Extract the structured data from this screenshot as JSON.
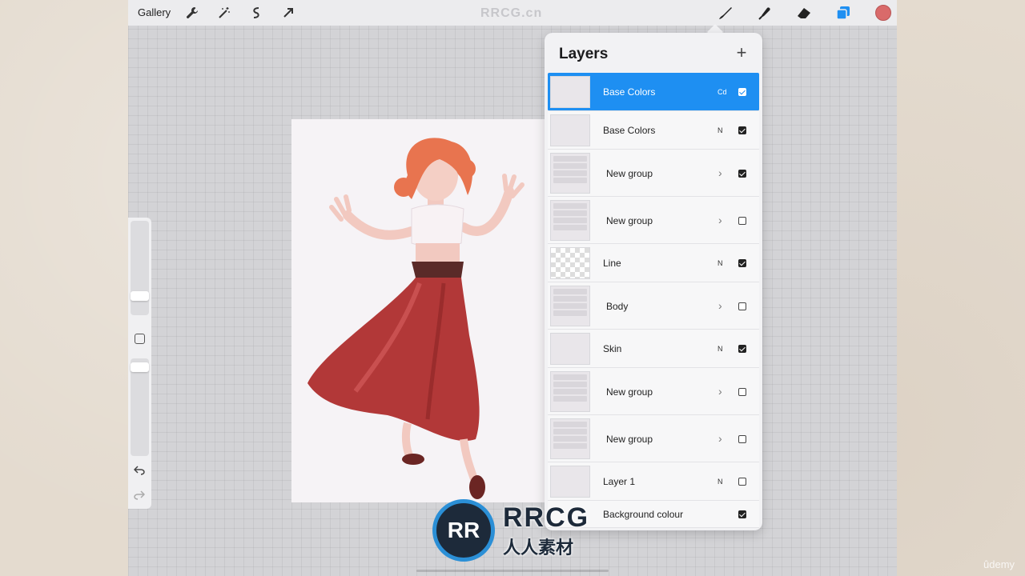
{
  "toolbar": {
    "gallery_label": "Gallery",
    "left_icons": [
      "wrench-icon",
      "magic-wand-icon",
      "selection-icon",
      "transform-arrow-icon"
    ],
    "right_icons": [
      "brush-icon",
      "smudge-icon",
      "eraser-icon",
      "layers-icon"
    ],
    "color_swatch": "#d96a6a",
    "accent": "#1e8ff2"
  },
  "watermark_top": "RRCG.cn",
  "layers_panel": {
    "title": "Layers",
    "add_icon": "+",
    "layers": [
      {
        "name": "Base Colors",
        "blend": "Cd",
        "checked": true,
        "selected": true,
        "group": false
      },
      {
        "name": "Base Colors",
        "blend": "N",
        "checked": true,
        "selected": false,
        "group": false
      },
      {
        "name": "New group",
        "blend": "",
        "checked": true,
        "selected": false,
        "group": true
      },
      {
        "name": "New group",
        "blend": "",
        "checked": false,
        "selected": false,
        "group": true
      },
      {
        "name": "Line",
        "blend": "N",
        "checked": true,
        "selected": false,
        "group": false
      },
      {
        "name": "Body",
        "blend": "",
        "checked": false,
        "selected": false,
        "group": true
      },
      {
        "name": "Skin",
        "blend": "N",
        "checked": true,
        "selected": false,
        "group": false
      },
      {
        "name": "New group",
        "blend": "",
        "checked": false,
        "selected": false,
        "group": true
      },
      {
        "name": "New group",
        "blend": "",
        "checked": false,
        "selected": false,
        "group": true
      },
      {
        "name": "Layer 1",
        "blend": "N",
        "checked": false,
        "selected": false,
        "group": false
      },
      {
        "name": "Background colour",
        "blend": "",
        "checked": true,
        "selected": false,
        "group": false
      }
    ]
  },
  "logo": {
    "initials": "RR",
    "en": "RRCG",
    "cn": "人人素材"
  },
  "udemy": "ûdemy"
}
